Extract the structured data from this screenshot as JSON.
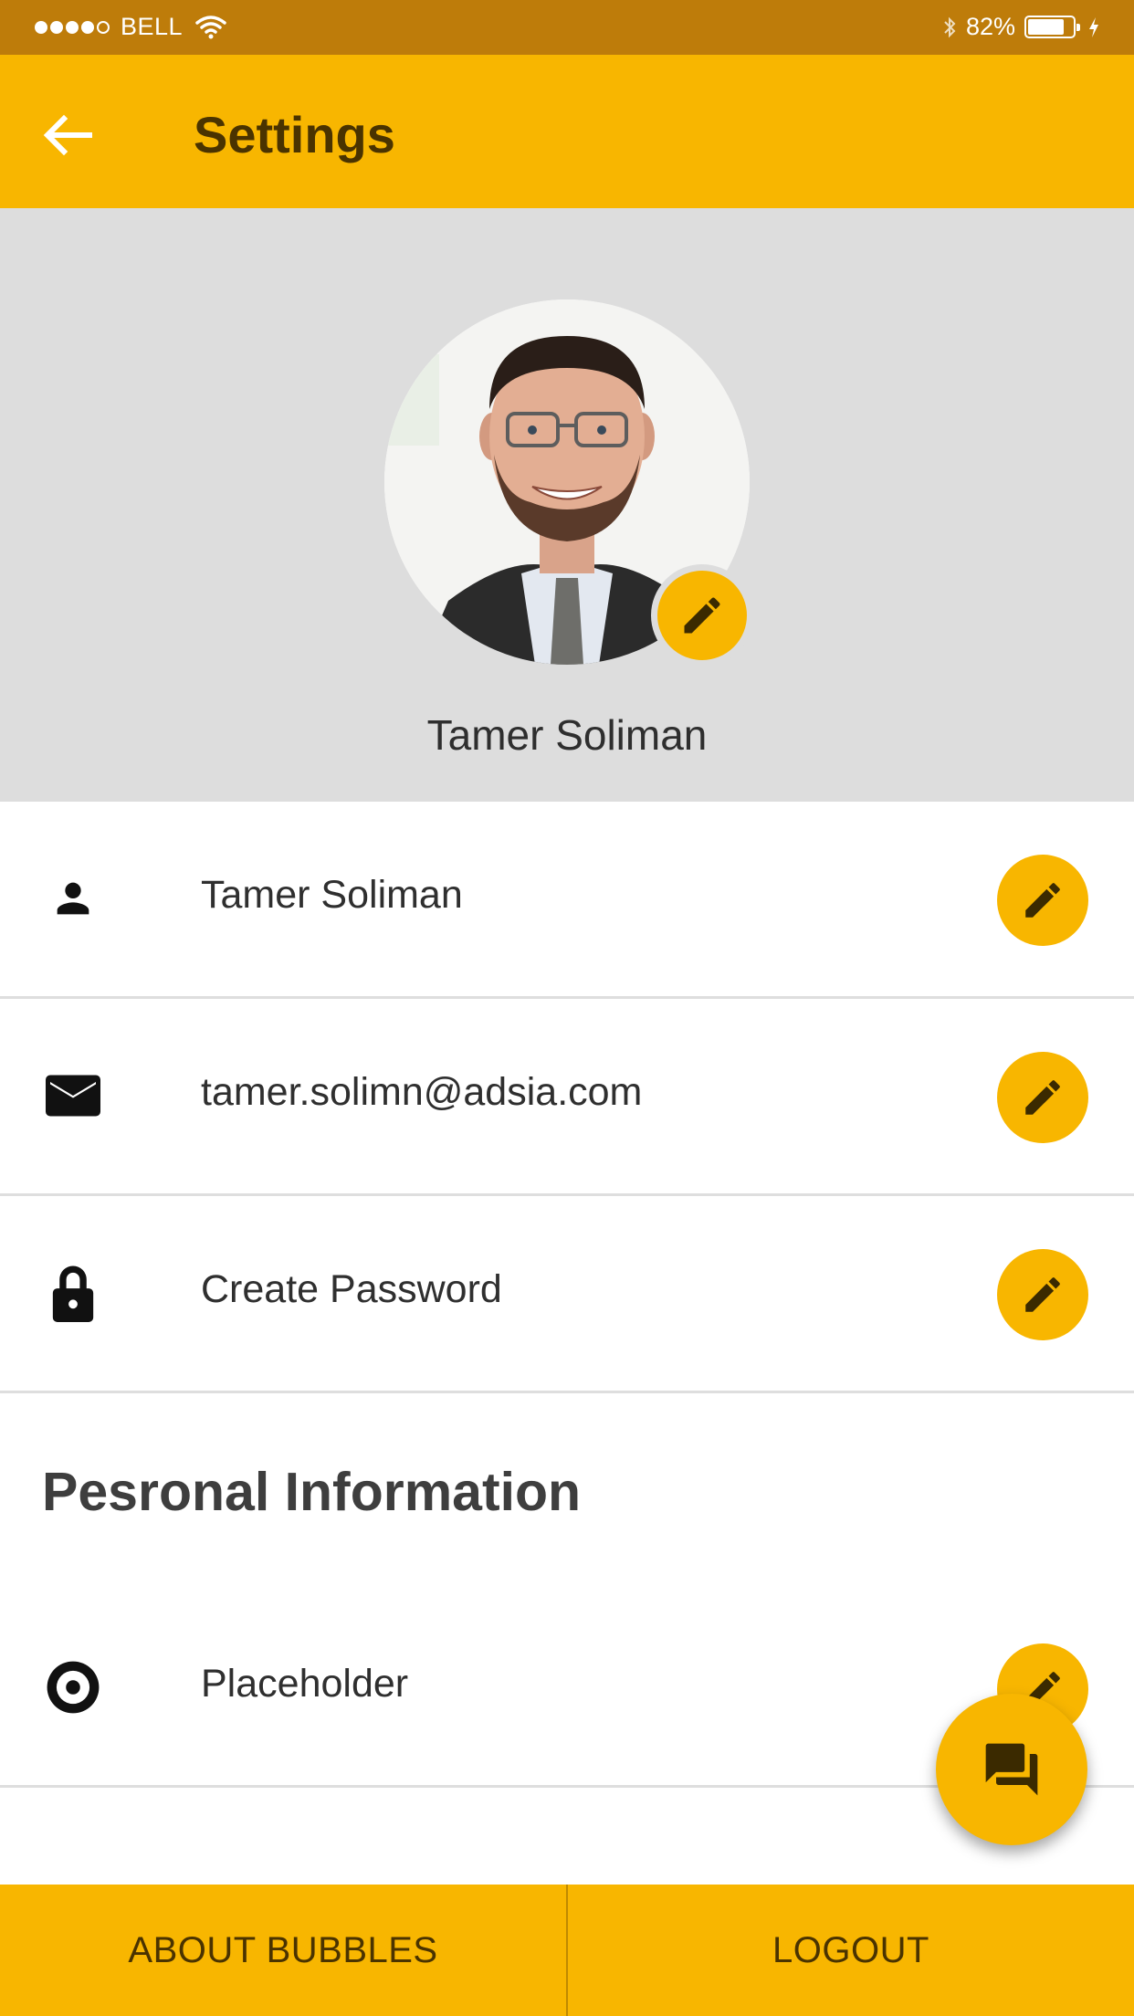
{
  "status_bar": {
    "carrier": "BELL",
    "signal_dots": [
      true,
      true,
      true,
      true,
      false
    ],
    "battery_percent": "82%",
    "battery_level": 0.82,
    "icons": [
      "wifi-icon",
      "bluetooth-icon",
      "battery-icon",
      "charging-icon"
    ]
  },
  "app_bar": {
    "title": "Settings",
    "back_icon": "arrow-back-icon"
  },
  "profile": {
    "name": "Tamer Soliman",
    "edit_icon": "pencil-icon"
  },
  "rows": [
    {
      "icon": "person-icon",
      "text": "Tamer Soliman"
    },
    {
      "icon": "mail-icon",
      "text": "tamer.solimn@adsia.com"
    },
    {
      "icon": "lock-icon",
      "text": "Create Password"
    }
  ],
  "section": {
    "title": "Pesronal Information"
  },
  "section_rows": [
    {
      "icon": "radio-icon",
      "text": "Placeholder"
    }
  ],
  "fab": {
    "icon": "forum-icon"
  },
  "bottom_bar": {
    "about_label": "ABOUT BUBBLES",
    "logout_label": "LOGOUT"
  },
  "colors": {
    "accent": "#F8B600",
    "status_bar": "#BE7C0A",
    "title_text": "#4A3300",
    "profile_bg": "#DDDDDD"
  }
}
